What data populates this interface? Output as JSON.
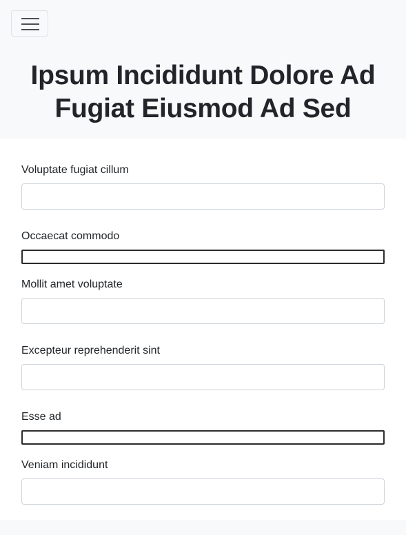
{
  "navbar": {
    "toggle_icon": "hamburger-menu-icon"
  },
  "hero": {
    "title": "Ipsum Incididunt Dolore Ad Fugiat Eiusmod Ad Sed"
  },
  "form": {
    "fields": [
      {
        "label": "Voluptate fugiat cillum",
        "value": ""
      },
      {
        "label": "Occaecat commodo",
        "value": ""
      },
      {
        "label": "Mollit amet voluptate",
        "value": ""
      },
      {
        "label": "Excepteur reprehenderit sint",
        "value": ""
      },
      {
        "label": "Esse ad",
        "value": ""
      },
      {
        "label": "Veniam incididunt",
        "value": ""
      }
    ]
  },
  "colors": {
    "header_background": "#f8f9fa",
    "text": "#212529",
    "input_border": "#ced4da"
  }
}
